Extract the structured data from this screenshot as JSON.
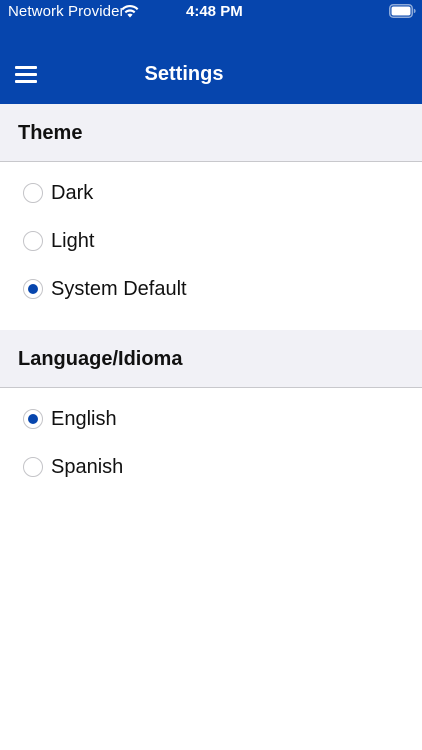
{
  "status_bar": {
    "carrier": "Network Provider",
    "time": "4:48 PM",
    "wifi_icon": "wifi-icon",
    "battery_icon": "battery-icon"
  },
  "header": {
    "title": "Settings",
    "menu_icon": "hamburger-menu-icon",
    "background_color": "#0645ad"
  },
  "sections": [
    {
      "title": "Theme",
      "options": [
        {
          "label": "Dark",
          "selected": false
        },
        {
          "label": "Light",
          "selected": false
        },
        {
          "label": "System Default",
          "selected": true
        }
      ]
    },
    {
      "title": "Language/Idioma",
      "options": [
        {
          "label": "English",
          "selected": true
        },
        {
          "label": "Spanish",
          "selected": false
        }
      ]
    }
  ],
  "colors": {
    "accent": "#0645ad",
    "section_background": "#f1f1f6",
    "radio_border": "#c4c4c8"
  }
}
